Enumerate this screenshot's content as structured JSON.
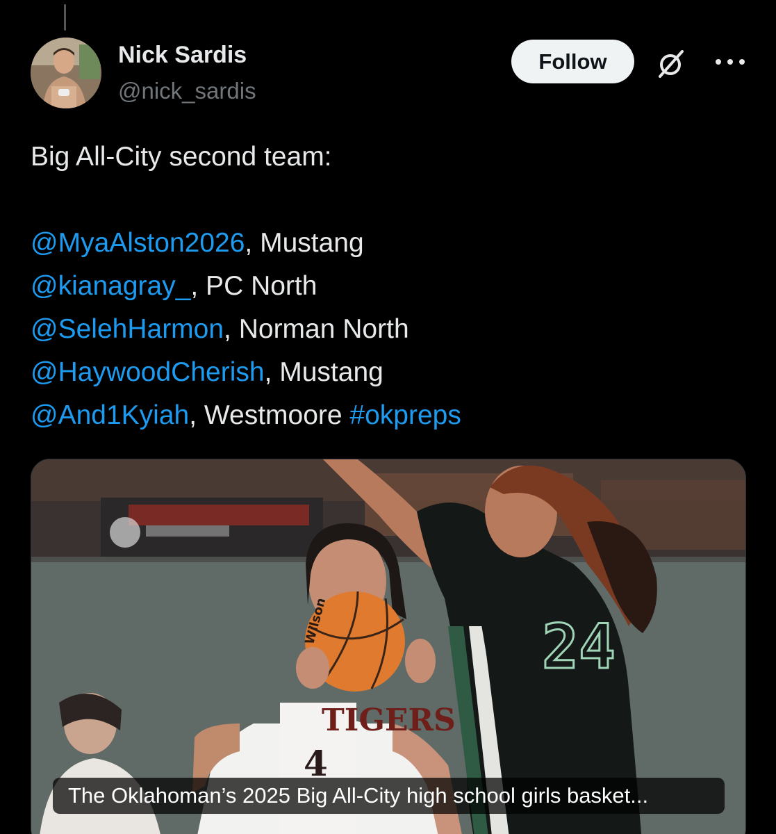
{
  "author": {
    "display_name": "Nick Sardis",
    "handle": "@nick_sardis",
    "avatar_icon": "profile-photo"
  },
  "actions": {
    "follow_label": "Follow",
    "grok_icon": "grok-icon",
    "more_icon": "more-icon"
  },
  "tweet": {
    "intro": "Big All-City second team:",
    "lines": [
      {
        "mention": "@MyaAlston2026",
        "rest": ", Mustang",
        "hashtag": ""
      },
      {
        "mention": "@kianagray_",
        "rest": ", PC North",
        "hashtag": ""
      },
      {
        "mention": "@SelehHarmon",
        "rest": ", Norman North",
        "hashtag": ""
      },
      {
        "mention": "@HaywoodCherish",
        "rest": ", Mustang",
        "hashtag": ""
      },
      {
        "mention": "@And1Kyiah",
        "rest": ", Westmoore ",
        "hashtag": "#okpreps"
      }
    ]
  },
  "media": {
    "jersey_left_text": "TIGERS",
    "jersey_left_number": "4",
    "jersey_right_number": "24",
    "ball_text": "Wilson",
    "caption": "The Oklahoman’s 2025 Big All-City high school girls basket..."
  },
  "colors": {
    "background": "#000000",
    "text": "#e7e9ea",
    "secondary": "#71767b",
    "link": "#1d9bf0",
    "follow_bg": "#eff3f4"
  }
}
